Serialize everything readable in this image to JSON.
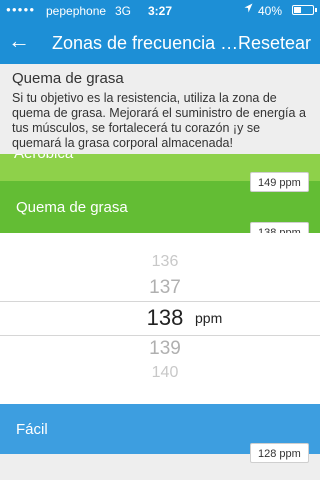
{
  "status_bar": {
    "signal": "●●●●●",
    "carrier": "pepephone",
    "network": "3G",
    "time": "3:27",
    "location_icon": "location-arrow-icon",
    "battery_text": "40%",
    "battery_level": 0.4
  },
  "nav": {
    "back_icon": "back-arrow-icon",
    "back_glyph": "←",
    "title": "Zonas de frecuencia cardíaca",
    "reset_label": "Resetear"
  },
  "info": {
    "title": "Quema de grasa",
    "text": "Si tu objetivo es la resistencia, utiliza la zona de quema de grasa. Mejorará el suministro de energía a tus músculos, se fortalecerá tu corazón ¡y se quemará la grasa corporal almacenada!"
  },
  "zones": {
    "aerobica": {
      "label": "Aeróbica",
      "ppm": "149  ppm"
    },
    "quema": {
      "label": "Quema de grasa",
      "ppm": "138  ppm"
    },
    "facil": {
      "label": "Fácil",
      "ppm": "128  ppm"
    }
  },
  "picker": {
    "above": [
      "136",
      "137"
    ],
    "selected": "138",
    "below": [
      "139",
      "140"
    ],
    "unit": "ppm"
  },
  "colors": {
    "nav_blue": "#1d8fd6",
    "aerobica_green": "#8ed14a",
    "quema_green": "#63bd34",
    "facil_blue": "#3d9ee0"
  }
}
